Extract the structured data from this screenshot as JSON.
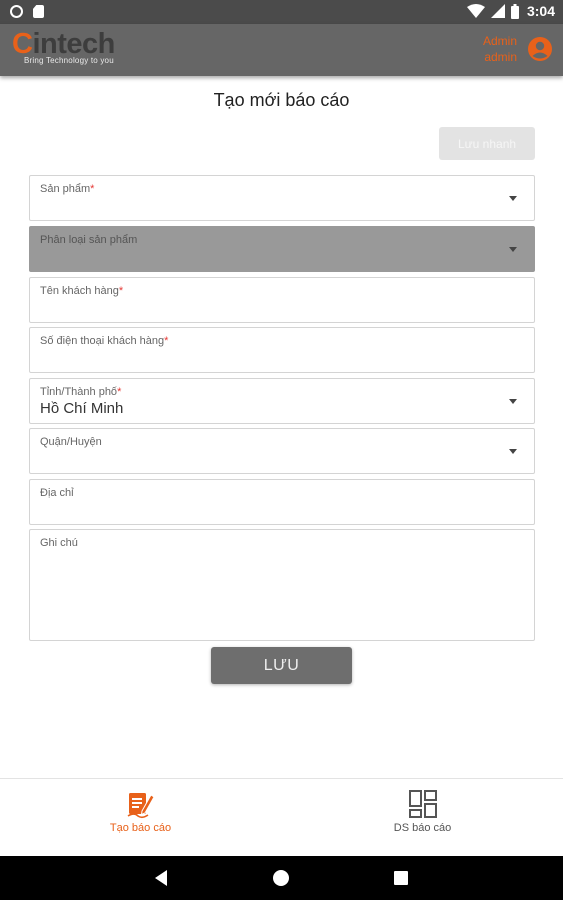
{
  "status_bar": {
    "time": "3:04",
    "icons": [
      "circle-icon",
      "sd-card-icon",
      "wifi-icon",
      "signal-icon",
      "battery-icon"
    ]
  },
  "app_bar": {
    "logo_first_letter": "C",
    "logo_rest": "intech",
    "logo_tagline": "Bring Technology to you",
    "user_name": "Admin",
    "user_role": "admin",
    "accent_color": "#e8611a"
  },
  "page": {
    "title": "Tạo mới báo cáo",
    "quick_save_label": "Lưu nhanh"
  },
  "form": {
    "san_pham": {
      "label": "Sản phẩm",
      "required": "*",
      "value": ""
    },
    "phan_loai": {
      "label": "Phân loại sản phẩm",
      "value": ""
    },
    "ten_khach_hang": {
      "label": "Tên khách hàng",
      "required": "*",
      "value": ""
    },
    "so_dien_thoai": {
      "label": "Số điện thoại khách hàng",
      "required": "*",
      "value": ""
    },
    "tinh_thanh_pho": {
      "label": "Tỉnh/Thành phố",
      "required": "*",
      "value": "Hồ Chí Minh"
    },
    "quan_huyen": {
      "label": "Quận/Huyện",
      "value": ""
    },
    "dia_chi": {
      "label": "Địa chỉ",
      "value": ""
    },
    "ghi_chu": {
      "label": "Ghi chú",
      "value": ""
    },
    "save_label": "LƯU"
  },
  "bottom_nav": {
    "items": [
      {
        "label": "Tạo báo cáo",
        "icon": "report-create-icon",
        "active": true
      },
      {
        "label": "DS báo cáo",
        "icon": "grid-list-icon",
        "active": false
      }
    ]
  }
}
